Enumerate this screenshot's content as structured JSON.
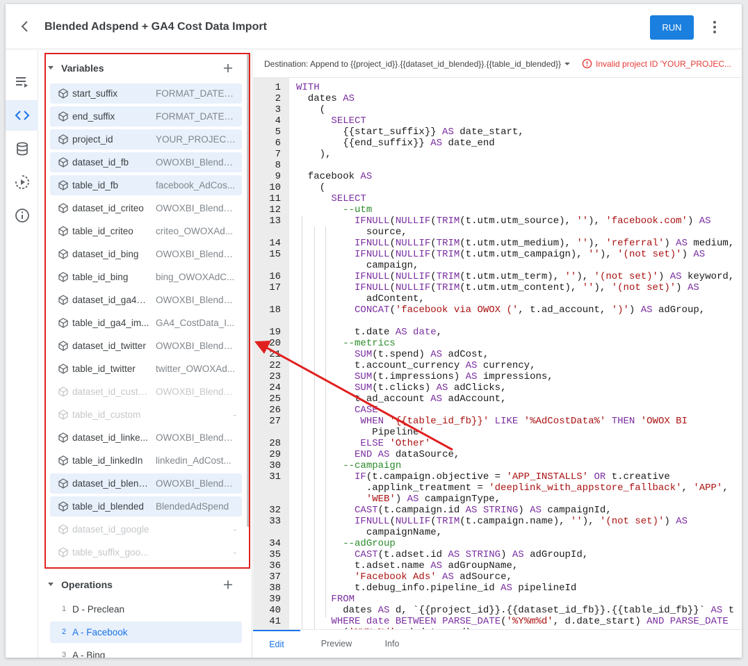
{
  "header": {
    "title": "Blended Adspend + GA4 Cost Data Import",
    "run_label": "RUN"
  },
  "rail": {
    "items": [
      "list-icon",
      "code-icon",
      "database-icon",
      "schedule-icon",
      "info-icon"
    ],
    "active": "code-icon"
  },
  "variables": {
    "heading": "Variables",
    "items": [
      {
        "name": "start_suffix",
        "value": "FORMAT_DATE('..."
      },
      {
        "name": "end_suffix",
        "value": "FORMAT_DATE('..."
      },
      {
        "name": "project_id",
        "value": "YOUR_PROJECT..."
      },
      {
        "name": "dataset_id_fb",
        "value": "OWOXBI_Blende..."
      },
      {
        "name": "table_id_fb",
        "value": "facebook_AdCos..."
      },
      {
        "name": "dataset_id_criteo",
        "value": "OWOXBI_Blende..."
      },
      {
        "name": "table_id_criteo",
        "value": "criteo_OWOXAd..."
      },
      {
        "name": "dataset_id_bing",
        "value": "OWOXBI_Blende..."
      },
      {
        "name": "table_id_bing",
        "value": "bing_OWOXAdC..."
      },
      {
        "name": "dataset_id_ga4_i...",
        "value": "OWOXBI_Blende..."
      },
      {
        "name": "table_id_ga4_im...",
        "value": "GA4_CostData_I..."
      },
      {
        "name": "dataset_id_twitter",
        "value": "OWOXBI_Blende..."
      },
      {
        "name": "table_id_twitter",
        "value": "twitter_OWOXAd..."
      },
      {
        "name": "dataset_id_custo...",
        "value": "OWOXBI_Blende..."
      },
      {
        "name": "table_id_custom",
        "value": "-"
      },
      {
        "name": "dataset_id_linke...",
        "value": "OWOXBI_Blende..."
      },
      {
        "name": "table_id_linkedIn",
        "value": "linkedin_AdCost..."
      },
      {
        "name": "dataset_id_blend...",
        "value": "OWOXBI_Blende..."
      },
      {
        "name": "table_id_blended",
        "value": "BlendedAdSpend"
      },
      {
        "name": "dataset_id_google",
        "value": "-"
      },
      {
        "name": "table_suffix_goo...",
        "value": "-"
      }
    ]
  },
  "operations": {
    "heading": "Operations",
    "items": [
      {
        "num": "1",
        "name": "D - Preclean"
      },
      {
        "num": "2",
        "name": "A - Facebook"
      },
      {
        "num": "3",
        "name": "A - Bing"
      }
    ]
  },
  "destination": {
    "text": "Destination: Append to {{project_id}}.{{dataset_id_blended}}.{{table_id_blended}}",
    "error": "Invalid project ID 'YOUR_PROJEC..."
  },
  "editor": {
    "lines": [
      {
        "n": "1",
        "t": "WITH"
      },
      {
        "n": "2",
        "t": "  dates AS"
      },
      {
        "n": "3",
        "t": "    ("
      },
      {
        "n": "4",
        "t": "      SELECT"
      },
      {
        "n": "5",
        "t": "        {{start_suffix}} AS date_start,"
      },
      {
        "n": "6",
        "t": "        {{end_suffix}} AS date_end"
      },
      {
        "n": "7",
        "t": "    ),"
      },
      {
        "n": "8",
        "t": ""
      },
      {
        "n": "9",
        "t": "  facebook AS"
      },
      {
        "n": "10",
        "t": "    ("
      },
      {
        "n": "11",
        "t": "      SELECT"
      },
      {
        "n": "12",
        "t": "        --utm"
      },
      {
        "n": "13",
        "t": "          IFNULL(NULLIF(TRIM(t.utm.utm_source), ''), 'facebook.com') AS"
      },
      {
        "n": "",
        "t": "            source,"
      },
      {
        "n": "14",
        "t": "          IFNULL(NULLIF(TRIM(t.utm.utm_medium), ''), 'referral') AS medium,"
      },
      {
        "n": "15",
        "t": "          IFNULL(NULLIF(TRIM(t.utm.utm_campaign), ''), '(not set)') AS"
      },
      {
        "n": "",
        "t": "            campaign,"
      },
      {
        "n": "16",
        "t": "          IFNULL(NULLIF(TRIM(t.utm.utm_term), ''), '(not set)') AS keyword,"
      },
      {
        "n": "17",
        "t": "          IFNULL(NULLIF(TRIM(t.utm.utm_content), ''), '(not set)') AS"
      },
      {
        "n": "",
        "t": "            adContent,"
      },
      {
        "n": "18",
        "t": "          CONCAT('facebook via OWOX (', t.ad_account, ')') AS adGroup,"
      },
      {
        "n": "",
        "t": ""
      },
      {
        "n": "19",
        "t": "          t.date AS date,"
      },
      {
        "n": "20",
        "t": "        --metrics"
      },
      {
        "n": "21",
        "t": "          SUM(t.spend) AS adCost,"
      },
      {
        "n": "22",
        "t": "          t.account_currency AS currency,"
      },
      {
        "n": "23",
        "t": "          SUM(t.impressions) AS impressions,"
      },
      {
        "n": "24",
        "t": "          SUM(t.clicks) AS adClicks,"
      },
      {
        "n": "25",
        "t": "          t.ad_account AS adAccount,"
      },
      {
        "n": "26",
        "t": "          CASE"
      },
      {
        "n": "27",
        "t": "           WHEN '{{table_id_fb}}' LIKE '%AdCostData%' THEN 'OWOX BI"
      },
      {
        "n": "",
        "t": "             Pipeline'"
      },
      {
        "n": "28",
        "t": "           ELSE 'Other'"
      },
      {
        "n": "29",
        "t": "          END AS dataSource,"
      },
      {
        "n": "30",
        "t": "        --campaign"
      },
      {
        "n": "31",
        "t": "          IF(t.campaign.objective = 'APP_INSTALLS' OR t.creative"
      },
      {
        "n": "",
        "t": "            .applink_treatment = 'deeplink_with_appstore_fallback', 'APP',"
      },
      {
        "n": "",
        "t": "            'WEB') AS campaignType,"
      },
      {
        "n": "32",
        "t": "          CAST(t.campaign.id AS STRING) AS campaignId,"
      },
      {
        "n": "33",
        "t": "          IFNULL(NULLIF(TRIM(t.campaign.name), ''), '(not set)') AS"
      },
      {
        "n": "",
        "t": "            campaignName,"
      },
      {
        "n": "34",
        "t": "        --adGroup"
      },
      {
        "n": "35",
        "t": "          CAST(t.adset.id AS STRING) AS adGroupId,"
      },
      {
        "n": "36",
        "t": "          t.adset.name AS adGroupName,"
      },
      {
        "n": "37",
        "t": "          'Facebook Ads' AS adSource,"
      },
      {
        "n": "38",
        "t": "          t.debug_info.pipeline_id AS pipelineId"
      },
      {
        "n": "39",
        "t": "      FROM"
      },
      {
        "n": "40",
        "t": "        dates AS d, `{{project_id}}.{{dataset_id_fb}}.{{table_id_fb}}` AS t"
      },
      {
        "n": "41",
        "t": "      WHERE date BETWEEN PARSE_DATE('%Y%m%d', d.date_start) AND PARSE_DATE"
      },
      {
        "n": "",
        "t": "        ('%Y%m%d', d.date_end)"
      }
    ]
  },
  "tabs": [
    {
      "label": "Edit"
    },
    {
      "label": "Preview"
    },
    {
      "label": "Info"
    }
  ],
  "colors": {
    "accent": "#1a7fde",
    "annotation": "#e02020",
    "error": "#e53935"
  }
}
